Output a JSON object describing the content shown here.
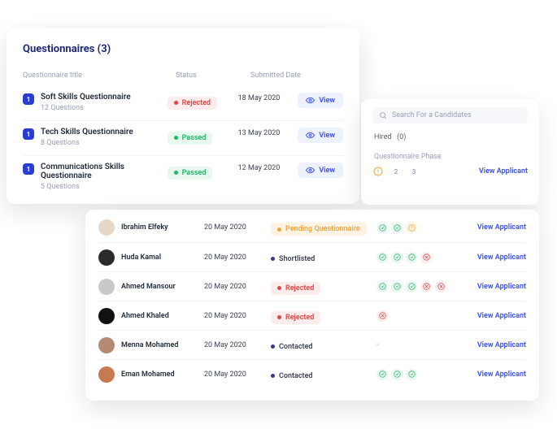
{
  "questionnaires": {
    "heading": "Questionnaires (3)",
    "columns": {
      "title": "Questionnaire title",
      "status": "Status",
      "date": "Submitted Date"
    },
    "view_label": "View",
    "items": [
      {
        "idx": "1",
        "title": "Soft Skills Questionnaire",
        "sub": "12 Questions",
        "status_kind": "reject",
        "status_label": "Rejected",
        "date": "18 May 2020"
      },
      {
        "idx": "1",
        "title": "Tech Skills Questionnaire",
        "sub": "8 Questions",
        "status_kind": "pass",
        "status_label": "Passed",
        "date": "13 May 2020"
      },
      {
        "idx": "1",
        "title": "Communications Skills Questionnaire",
        "sub": "5 Questions",
        "status_kind": "pass",
        "status_label": "Passed",
        "date": "12 May 2020"
      }
    ]
  },
  "side": {
    "search_placeholder": "Search For a Candidates",
    "hired_label": "Hired",
    "hired_count": "(0)",
    "phase_label": "Questionnaire Phase",
    "phase_steps": [
      "!",
      "2",
      "3"
    ],
    "view_applicant": "View Applicant"
  },
  "applicants": {
    "view_applicant": "View Applicant",
    "rows": [
      {
        "name": "Ibrahim Elfeky",
        "date": "20 May 2020",
        "status_kind": "pending",
        "status_label": "Pending Questionnaire",
        "rings": [
          "green",
          "green",
          "orange"
        ],
        "avatar": "#e8d7c7"
      },
      {
        "name": "Huda Kamal",
        "date": "20 May 2020",
        "status_kind": "plain",
        "status_label": "Shortlisted",
        "rings": [
          "green",
          "green",
          "green",
          "red"
        ],
        "avatar": "#2b2b2b"
      },
      {
        "name": "Ahmed Mansour",
        "date": "20 May 2020",
        "status_kind": "reject",
        "status_label": "Rejected",
        "rings": [
          "green",
          "green",
          "green",
          "red",
          "red"
        ],
        "avatar": "#c9c9c9"
      },
      {
        "name": "Ahmed Khaled",
        "date": "20 May 2020",
        "status_kind": "reject",
        "status_label": "Rejected",
        "rings": [
          "red"
        ],
        "avatar": "#111111"
      },
      {
        "name": "Menna Mohamed",
        "date": "20 May 2020",
        "status_kind": "plain",
        "status_label": "Contacted",
        "rings": [],
        "avatar": "#b48a74"
      },
      {
        "name": "Eman Mohamed",
        "date": "20 May 2020",
        "status_kind": "plain",
        "status_label": "Contacted",
        "rings": [
          "green",
          "green",
          "green"
        ],
        "avatar": "#c77a52"
      }
    ]
  }
}
